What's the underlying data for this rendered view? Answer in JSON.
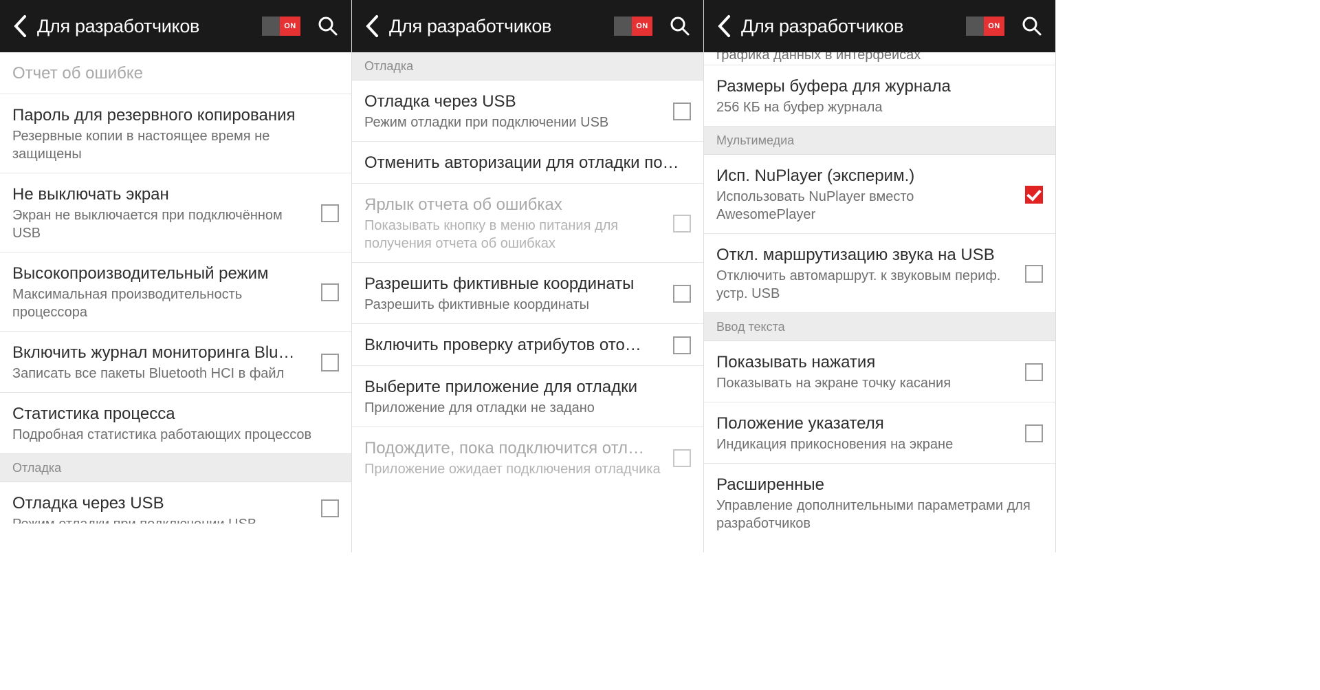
{
  "header": {
    "title": "Для разработчиков",
    "toggle_on": "ON"
  },
  "panel1": {
    "items": [
      {
        "title": "Отчет об ошибке"
      },
      {
        "title": "Пароль для резервного копирования",
        "sub": "Резервные копии в настоящее время не защищены"
      },
      {
        "title": "Не выключать экран",
        "sub": "Экран не выключается при подключённом USB"
      },
      {
        "title": "Высокопроизводительный режим",
        "sub": "Максимальная производительность процессора"
      },
      {
        "title": "Включить журнал мониторинга Blu…",
        "sub": "Записать все пакеты Bluetooth HCI в файл"
      },
      {
        "title": "Статистика процесса",
        "sub": "Подробная статистика работающих процессов"
      }
    ],
    "section": "Отладка",
    "after_section": {
      "title": "Отладка через USB",
      "sub": "Режим отладки при подключении USB"
    }
  },
  "panel2": {
    "section": "Отладка",
    "items": [
      {
        "title": "Отладка через USB",
        "sub": "Режим отладки при подключении USB"
      },
      {
        "title": "Отменить авторизации для отладки по…"
      },
      {
        "title": "Ярлык отчета об ошибках",
        "sub": "Показывать кнопку в меню питания для получения отчета об ошибках"
      },
      {
        "title": "Разрешить фиктивные координаты",
        "sub": "Разрешить фиктивные координаты"
      },
      {
        "title": "Включить проверку атрибутов ото…"
      },
      {
        "title": "Выберите приложение для отладки",
        "sub": "Приложение для отладки не задано"
      },
      {
        "title": "Подождите, пока подключится отл…",
        "sub": "Приложение ожидает подключения отладчика"
      }
    ]
  },
  "panel3": {
    "peek": "графика данных в интерфейсах",
    "top_item": {
      "title": "Размеры буфера для журнала",
      "sub": "256 КБ на буфер журнала"
    },
    "section_multimedia": "Мультимедиа",
    "multimedia": [
      {
        "title": "Исп. NuPlayer (эксперим.)",
        "sub": "Использовать NuPlayer вместо AwesomePlayer"
      },
      {
        "title": "Откл. маршрутизацию звука на USB",
        "sub": "Отключить автомаршрут. к звуковым периф. устр. USB"
      }
    ],
    "section_input": "Ввод текста",
    "input": [
      {
        "title": "Показывать нажатия",
        "sub": "Показывать на экране точку касания"
      },
      {
        "title": "Положение указателя",
        "sub": "Индикация прикосновения на экране"
      },
      {
        "title": "Расширенные",
        "sub": "Управление дополнительными параметрами для разработчиков"
      }
    ]
  }
}
